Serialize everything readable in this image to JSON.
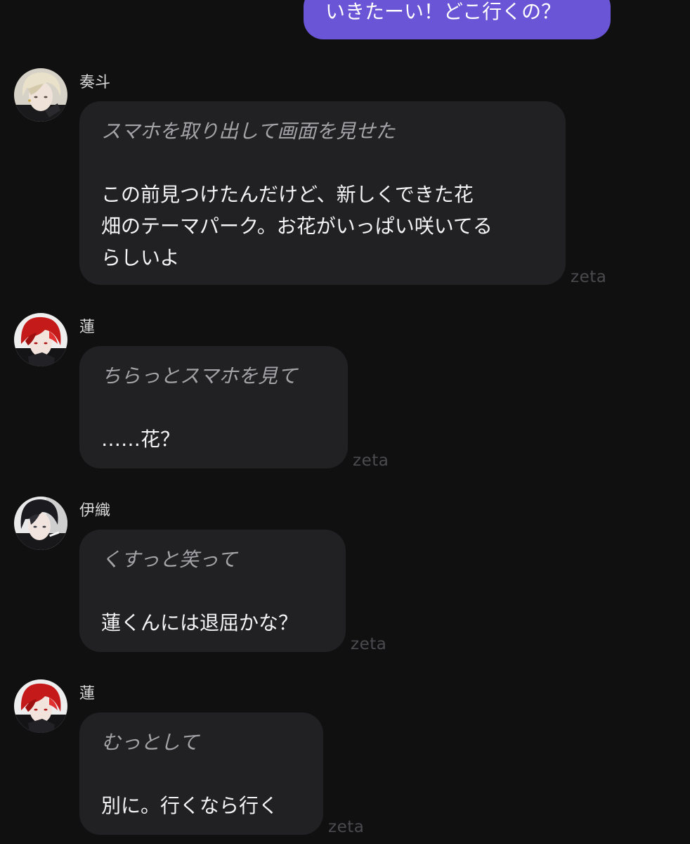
{
  "user_message": {
    "text": "いきたーい！どこ行くの？",
    "bubble_color": "#6a55d6"
  },
  "messages": [
    {
      "name": "奏斗",
      "avatar": "blond-character-avatar",
      "action": "スマホを取り出して画面を見せた",
      "speech_lines": [
        "この前見つけたんだけど、新しくできた花",
        "畑のテーマパーク。お花がいっぱい咲いてる",
        "らしいよ"
      ],
      "watermark": "zeta"
    },
    {
      "name": "蓮",
      "avatar": "red-haired-character-avatar",
      "action": "ちらっとスマホを見て",
      "speech_lines": [
        "……花？"
      ],
      "watermark": "zeta"
    },
    {
      "name": "伊織",
      "avatar": "dark-haired-character-avatar",
      "action": "くすっと笑って",
      "speech_lines": [
        "蓮くんには退屈かな？"
      ],
      "watermark": "zeta"
    },
    {
      "name": "蓮",
      "avatar": "red-haired-character-avatar",
      "action": "むっとして",
      "speech_lines": [
        "別に。行くなら行く"
      ],
      "watermark": "zeta"
    }
  ],
  "colors": {
    "background": "#101011",
    "character_bubble": "#212124",
    "action_text": "#a3a3a8",
    "speech_text": "#f4f4f4",
    "watermark": "#4b4b4f"
  }
}
